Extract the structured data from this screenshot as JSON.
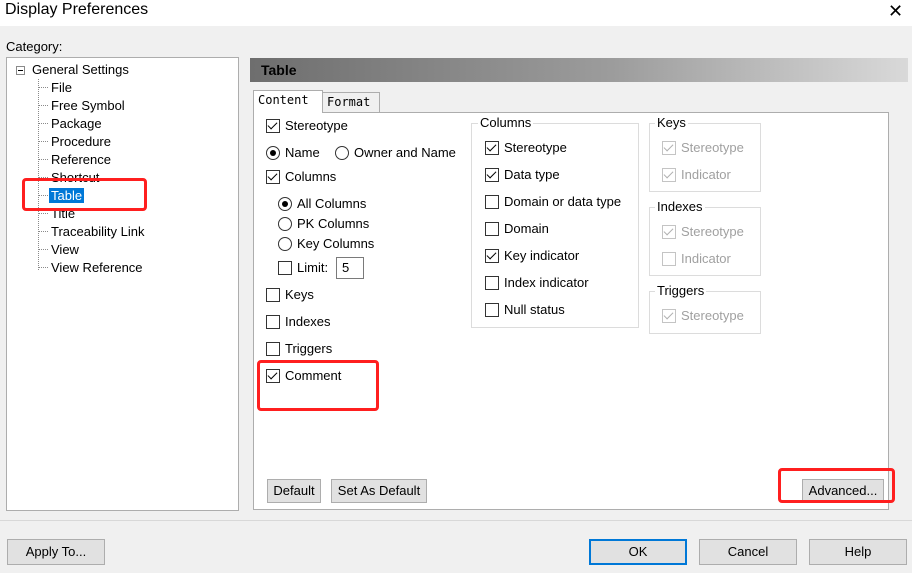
{
  "window": {
    "title": "Display Preferences",
    "close_glyph": "✕"
  },
  "category": {
    "label": "Category:",
    "root": "General Settings",
    "items": [
      "File",
      "Free Symbol",
      "Package",
      "Procedure",
      "Reference",
      "Shortcut",
      "Table",
      "Title",
      "Traceability Link",
      "View",
      "View Reference"
    ],
    "selected": "Table"
  },
  "header": {
    "title": "Table"
  },
  "tabs": [
    "Content",
    "Format"
  ],
  "content": {
    "stereotype": {
      "label": "Stereotype",
      "checked": true
    },
    "name_radio": {
      "label": "Name",
      "checked": true
    },
    "owner_name_radio": {
      "label": "Owner and Name",
      "checked": false
    },
    "columns": {
      "label": "Columns",
      "checked": true
    },
    "all_columns": {
      "label": "All Columns",
      "checked": true
    },
    "pk_columns": {
      "label": "PK Columns",
      "checked": false
    },
    "key_columns": {
      "label": "Key Columns",
      "checked": false
    },
    "limit": {
      "label": "Limit:",
      "checked": false,
      "value": "5"
    },
    "keys": {
      "label": "Keys",
      "checked": false
    },
    "indexes": {
      "label": "Indexes",
      "checked": false
    },
    "triggers": {
      "label": "Triggers",
      "checked": false
    },
    "comment": {
      "label": "Comment",
      "checked": true
    }
  },
  "columns_group": {
    "title": "Columns",
    "items": [
      {
        "label": "Stereotype",
        "checked": true
      },
      {
        "label": "Data type",
        "checked": true
      },
      {
        "label": "Domain or data type",
        "checked": false
      },
      {
        "label": "Domain",
        "checked": false
      },
      {
        "label": "Key indicator",
        "checked": true
      },
      {
        "label": "Index indicator",
        "checked": false
      },
      {
        "label": "Null status",
        "checked": false
      }
    ]
  },
  "keys_group": {
    "title": "Keys",
    "items": [
      {
        "label": "Stereotype",
        "checked": true
      },
      {
        "label": "Indicator",
        "checked": true
      }
    ]
  },
  "indexes_group": {
    "title": "Indexes",
    "items": [
      {
        "label": "Stereotype",
        "checked": true
      },
      {
        "label": "Indicator",
        "checked": false
      }
    ]
  },
  "triggers_group": {
    "title": "Triggers",
    "items": [
      {
        "label": "Stereotype",
        "checked": true
      }
    ]
  },
  "buttons": {
    "default": "Default",
    "set_as_default": "Set As Default",
    "advanced": "Advanced...",
    "apply_to": "Apply To...",
    "ok": "OK",
    "cancel": "Cancel",
    "help": "Help"
  },
  "colors": {
    "selection": "#0078d7",
    "highlight_box": "#ff1f1f",
    "header_gradient_start": "#6e6e6e"
  }
}
